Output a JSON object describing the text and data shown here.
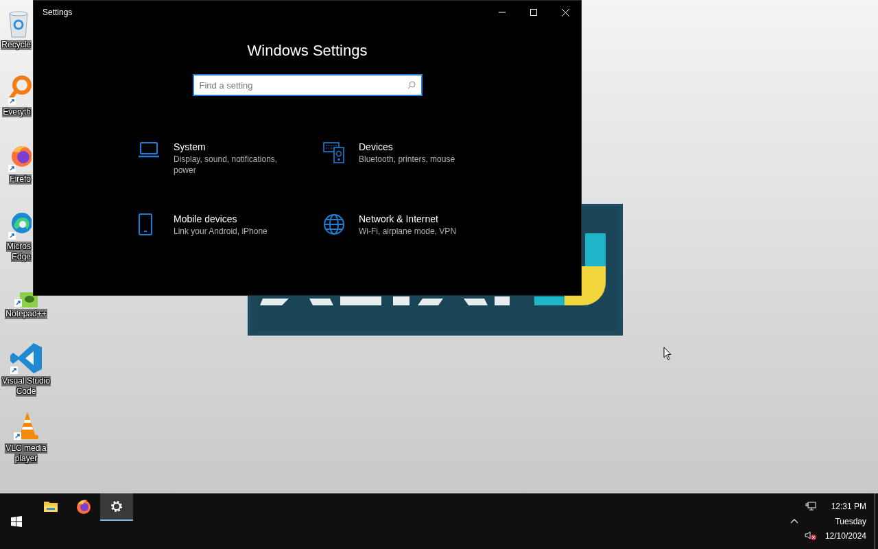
{
  "desktop": {
    "icons": [
      {
        "kind": "recycle",
        "label_lines": [
          "Recycle"
        ]
      },
      {
        "kind": "search-app",
        "label_lines": [
          "Everyth"
        ]
      },
      {
        "kind": "firefox",
        "label_lines": [
          "Firefo"
        ]
      },
      {
        "kind": "edge",
        "label_lines": [
          "Micros",
          "Edge"
        ]
      },
      {
        "kind": "notepad",
        "label_lines": [
          "Notepad++"
        ]
      },
      {
        "kind": "vscode",
        "label_lines": [
          "Visual Studio",
          "Code"
        ]
      },
      {
        "kind": "vlc",
        "label_lines": [
          "VLC media",
          "player"
        ]
      }
    ]
  },
  "window": {
    "title": "Settings",
    "heading": "Windows Settings",
    "search": {
      "placeholder": "Find a setting"
    },
    "categories": [
      {
        "kind": "laptop",
        "title": "System",
        "description": "Display, sound, notifications, power"
      },
      {
        "kind": "devices",
        "title": "Devices",
        "description": "Bluetooth, printers, mouse"
      },
      {
        "kind": "phone",
        "title": "Mobile devices",
        "description": "Link your Android, iPhone"
      },
      {
        "kind": "globe",
        "title": "Network & Internet",
        "description": "Wi-Fi, airplane mode, VPN"
      }
    ]
  },
  "taskbar": {
    "apps": [
      {
        "kind": "folder",
        "selected": false
      },
      {
        "kind": "firefox",
        "selected": false
      },
      {
        "kind": "gear",
        "selected": true
      }
    ],
    "clock": {
      "time": "12:31 PM",
      "day": "Tuesday",
      "date": "12/10/2024"
    }
  }
}
